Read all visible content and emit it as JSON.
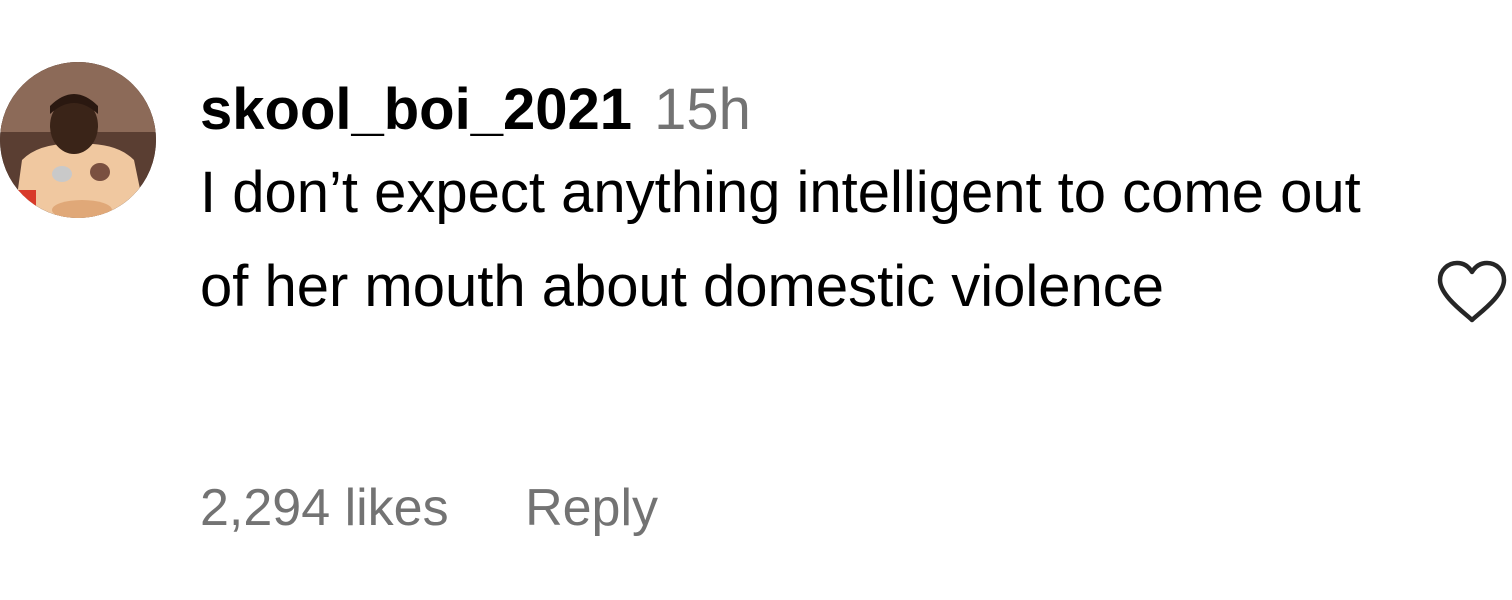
{
  "comment": {
    "username": "skool_boi_2021",
    "timestamp": "15h",
    "text": "I don’t expect anything intelligent to come out of her mouth about domestic violence",
    "likes": "2,294 likes",
    "reply_label": "Reply",
    "like_icon": "heart-outline-icon",
    "avatar_icon": "user-avatar-photo"
  },
  "colors": {
    "primary_text": "#000000",
    "secondary_text": "#737373",
    "background": "#ffffff"
  }
}
